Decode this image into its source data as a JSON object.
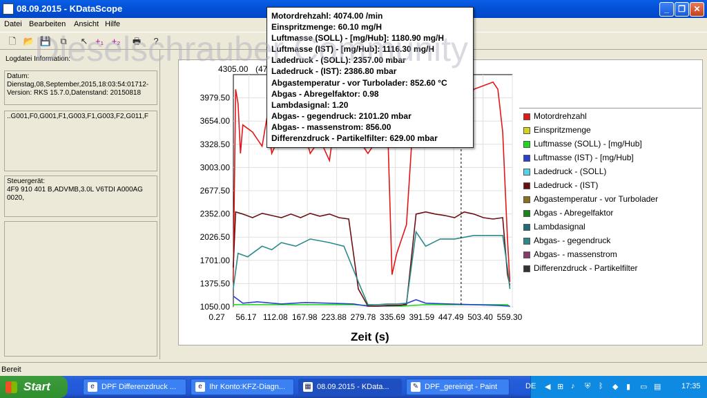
{
  "window": {
    "title": "08.09.2015 - KDataScope"
  },
  "menu": [
    "Datei",
    "Bearbeiten",
    "Ansicht",
    "Hilfe"
  ],
  "watermark": "Dieselschrauber Community",
  "left_panel": {
    "header": "Logdatei Information:",
    "datum_label": "Datum:",
    "datum_value": "Dienstag,08,September,2015,18:03:54:01712-",
    "version": "Version: RKS 15.7.0,Datenstand: 20150818",
    "groups": "..G001,F0,G001,F1,G003,F1,G003,F2,G011,F",
    "steuergeraet_label": "Steuergerät:",
    "steuergeraet_value": "4F9 910 401 B,ADVMB,3.0L V6TDI  A000AG 0020,"
  },
  "tooltip": [
    "Motordrehzahl: 4074.00  /min",
    "Einspritzmenge: 60.10  mg/H",
    "Luftmasse (SOLL) - [mg/Hub]: 1180.90  mg/H",
    "Luftmasse (IST) - [mg/Hub]: 1116.30  mg/H",
    "Ladedruck - (SOLL): 2357.00  mbar",
    "Ladedruck - (IST): 2386.80  mbar",
    "Abgastemperatur - vor Turbolader: 852.60 °C",
    "Abgas - Abregelfaktor: 0.98",
    "Lambdasignal: 1.20",
    "Abgas- - gegendruck: 2101.20  mbar",
    "Abgas- - massenstrom: 856.00",
    "Differenzdruck - Partikelfilter: 629.00  mbar"
  ],
  "chart_data": {
    "type": "line",
    "xlabel": "Zeit (s)",
    "y_top_label": "4305.00",
    "y_top_extra": "(473.63s",
    "yticks": [
      "3979.50",
      "3654.00",
      "3328.50",
      "3003.00",
      "2677.50",
      "2352.00",
      "2026.50",
      "1701.00",
      "1375.50",
      "1050.00"
    ],
    "xticks": [
      "0.27",
      "56.17",
      "112.08",
      "167.98",
      "223.88",
      "279.78",
      "335.69",
      "391.59",
      "447.49",
      "503.40",
      "559.30"
    ],
    "ylim": [
      1050,
      4305
    ],
    "xlim": [
      0.27,
      580
    ],
    "cursor_x": 473.63,
    "series": [
      {
        "name": "Motordrehzahl",
        "color": "#e31515",
        "x": [
          0,
          5,
          10,
          15,
          20,
          40,
          60,
          70,
          80,
          100,
          120,
          140,
          160,
          180,
          200,
          210,
          220,
          240,
          260,
          280,
          300,
          310,
          320,
          330,
          340,
          350,
          360,
          380,
          400,
          420,
          440,
          460,
          480,
          500,
          520,
          540,
          550,
          560,
          570,
          575
        ],
        "y": [
          1400,
          4100,
          3900,
          3200,
          3600,
          3500,
          3300,
          3700,
          3200,
          3500,
          3300,
          3700,
          3200,
          3400,
          3100,
          3600,
          3300,
          3500,
          3400,
          3200,
          3400,
          3600,
          3800,
          1500,
          1800,
          2000,
          2200,
          4300,
          3800,
          3500,
          3700,
          3600,
          3800,
          4100,
          4150,
          4200,
          4100,
          3500,
          2000,
          1400
        ]
      },
      {
        "name": "Einspritzmenge",
        "color": "#d4d41a",
        "x": [],
        "y": []
      },
      {
        "name": "Luftmasse (SOLL) - [mg/Hub]",
        "color": "#1adc1a",
        "x": [
          0,
          50,
          100,
          200,
          250,
          300,
          350,
          400,
          500,
          560,
          570,
          575
        ],
        "y": [
          1080,
          1080,
          1080,
          1080,
          1080,
          1060,
          1060,
          1080,
          1080,
          1080,
          1080,
          1050
        ]
      },
      {
        "name": "Luftmasse (IST) - [mg/Hub]",
        "color": "#2a3fd4",
        "x": [
          0,
          10,
          20,
          50,
          100,
          150,
          200,
          250,
          280,
          300,
          350,
          380,
          400,
          450,
          500,
          550,
          575
        ],
        "y": [
          1200,
          1150,
          1100,
          1120,
          1090,
          1110,
          1100,
          1090,
          1060,
          1060,
          1070,
          1150,
          1100,
          1090,
          1080,
          1070,
          1060
        ]
      },
      {
        "name": "Ladedruck - (SOLL)",
        "color": "#4fd4e8",
        "x": [],
        "y": []
      },
      {
        "name": "Ladedruck - (IST)",
        "color": "#6b0f0f",
        "x": [
          0,
          5,
          20,
          40,
          60,
          80,
          100,
          120,
          140,
          160,
          180,
          200,
          220,
          240,
          260,
          280,
          300,
          320,
          340,
          360,
          380,
          400,
          420,
          440,
          460,
          480,
          500,
          520,
          540,
          560,
          570,
          575
        ],
        "y": [
          1600,
          2380,
          2350,
          2300,
          2360,
          2330,
          2300,
          2350,
          2300,
          2360,
          2320,
          2350,
          2300,
          2280,
          1300,
          1060,
          1060,
          1070,
          1070,
          1080,
          2350,
          2380,
          2350,
          2330,
          2300,
          2380,
          2350,
          2300,
          2280,
          2300,
          1500,
          1350
        ]
      },
      {
        "name": "Abgastemperatur - vor Turbolader",
        "color": "#8b6f1a",
        "x": [],
        "y": []
      },
      {
        "name": "Abgas - Abregelfaktor",
        "color": "#148a14",
        "x": [],
        "y": []
      },
      {
        "name": "Lambdasignal",
        "color": "#1f6b78",
        "x": [],
        "y": []
      },
      {
        "name": "Abgas- - gegendruck",
        "color": "#2a8a8a",
        "x": [
          0,
          10,
          30,
          60,
          80,
          100,
          130,
          160,
          200,
          230,
          260,
          280,
          300,
          320,
          340,
          360,
          380,
          400,
          430,
          460,
          500,
          540,
          560,
          570,
          575
        ],
        "y": [
          1300,
          1800,
          1750,
          1900,
          1850,
          1950,
          1900,
          2000,
          1950,
          1900,
          1400,
          1080,
          1080,
          1090,
          1090,
          1100,
          2100,
          1900,
          2000,
          2000,
          2050,
          2050,
          2050,
          1600,
          1300
        ]
      },
      {
        "name": "Abgas- - massenstrom",
        "color": "#8a3a6a",
        "x": [],
        "y": []
      },
      {
        "name": "Differenzdruck - Partikelfilter",
        "color": "#333333",
        "x": [],
        "y": []
      }
    ]
  },
  "status": {
    "text": "Bereit"
  },
  "taskbar": {
    "start": "Start",
    "tasks": [
      "DPF Differenzdruck ...",
      "Ihr Konto:KFZ-Diagn...",
      "08.09.2015 - KData...",
      "DPF_gereinigt - Paint"
    ],
    "lang": "DE",
    "clock": "17:35"
  }
}
